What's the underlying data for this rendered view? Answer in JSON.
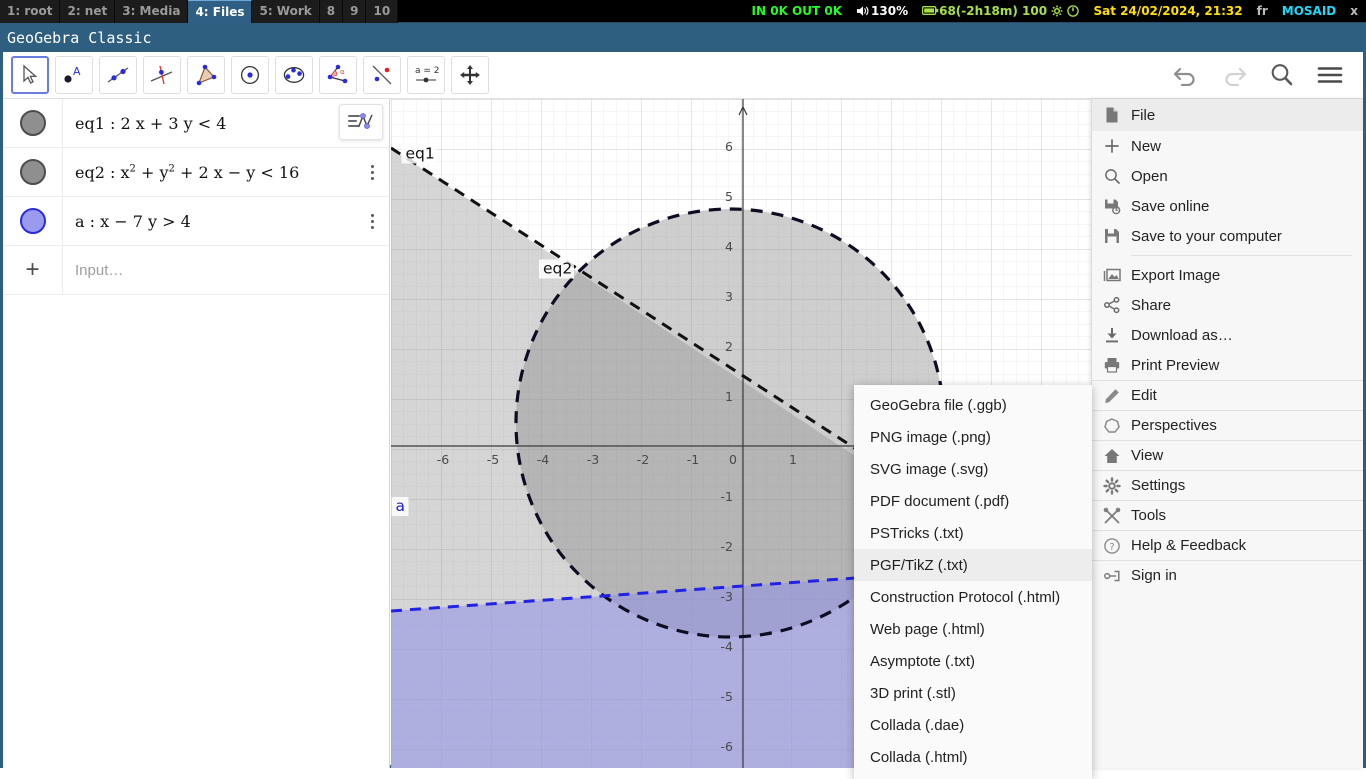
{
  "statusbar": {
    "workspaces": [
      {
        "label": "1: root",
        "selected": false
      },
      {
        "label": "2: net",
        "selected": false
      },
      {
        "label": "3: Media",
        "selected": false
      },
      {
        "label": "4: Files",
        "selected": true
      },
      {
        "label": "5: Work",
        "selected": false
      },
      {
        "label": "8",
        "selected": false
      },
      {
        "label": "9",
        "selected": false
      },
      {
        "label": "10",
        "selected": false
      }
    ],
    "net": "IN 0K OUT 0K",
    "volume": "130%",
    "battery": "68(-2h18m) 100",
    "datetime": "Sat 24/02/2024, 21:32",
    "keyboard": "fr",
    "host": "MOSAID",
    "close": "x"
  },
  "window": {
    "title": "GeoGebra Classic"
  },
  "toolbar": {
    "tools": [
      {
        "name": "move-tool",
        "active": true
      },
      {
        "name": "point-tool",
        "active": false
      },
      {
        "name": "line-tool",
        "active": false
      },
      {
        "name": "perpendicular-line-tool",
        "active": false
      },
      {
        "name": "polygon-tool",
        "active": false
      },
      {
        "name": "circle-tool",
        "active": false
      },
      {
        "name": "ellipse-tool",
        "active": false
      },
      {
        "name": "angle-tool",
        "active": false
      },
      {
        "name": "reflect-tool",
        "active": false
      },
      {
        "name": "slider-tool",
        "active": false
      },
      {
        "name": "move-graphics-tool",
        "active": false
      }
    ],
    "undo": "undo-icon",
    "redo": "redo-icon",
    "search": "search-icon",
    "menu": "hamburger-menu-icon"
  },
  "algebra": {
    "stylebar": "algebra-stylebar-icon",
    "rows": [
      {
        "name": "eq1",
        "expr_html": "eq1 : 2 x + 3 y &lt; 4",
        "color": "#8f8f8f",
        "visible": true
      },
      {
        "name": "eq2",
        "expr_html": "eq2 : x<sup>2</sup> + y<sup>2</sup> + 2 x &minus; y &lt; 16",
        "color": "#8f8f8f",
        "visible": true
      },
      {
        "name": "a",
        "expr_html": "a : x &minus; 7 y &gt; 4",
        "color": "#9a9aef",
        "visible": true
      }
    ],
    "input_placeholder": "Input…"
  },
  "chart_data": {
    "type": "scatter",
    "title": "",
    "xlabel": "x",
    "ylabel": "y",
    "xlim": [
      -7.1,
      2.4
    ],
    "ylim": [
      -6.6,
      6.6
    ],
    "grid": true,
    "xticks": [
      -6,
      -5,
      -4,
      -3,
      -2,
      -1,
      0,
      1
    ],
    "yticks": [
      6,
      5,
      4,
      3,
      2,
      1,
      -1,
      -2,
      -3,
      -4,
      -5,
      -6
    ],
    "annotations": [
      {
        "text": "eq1",
        "x": -6.75,
        "y": 5.75
      },
      {
        "text": "eq2",
        "x": -4.0,
        "y": 3.45
      },
      {
        "text": "a",
        "x": -6.95,
        "y": -1.3
      }
    ],
    "series": [
      {
        "name": "eq1",
        "label": "2x + 3y < 4",
        "kind": "linear-inequality",
        "color": "#000000",
        "fill": "#8c8c8c",
        "style": "dashed",
        "boundary_points": [
          [
            -7.1,
            6.07
          ],
          [
            2.4,
            -0.27
          ]
        ]
      },
      {
        "name": "eq2",
        "label": "x² + y² + 2x − y < 16",
        "kind": "circle-inequality",
        "color": "#101028",
        "fill": "#6e6e6e",
        "style": "dashed",
        "center": [
          -1,
          0.5
        ],
        "radius": 4.27
      },
      {
        "name": "a",
        "label": "x − 7y > 4",
        "kind": "linear-inequality",
        "color": "#2020e0",
        "fill": "#8f8fe8",
        "style": "dashed",
        "boundary_points": [
          [
            -7.1,
            -1.586
          ],
          [
            2.4,
            -0.229
          ]
        ]
      }
    ]
  },
  "graphics": {
    "stylebar": "graphics-stylebar-icon",
    "zoom_in": "zoom-in-icon",
    "zoom_out": "zoom-out-icon",
    "fit": "fit-to-screen-icon"
  },
  "mainmenu": {
    "items": [
      {
        "label": "File",
        "icon": "file-icon",
        "header": true
      },
      {
        "label": "New",
        "icon": "plus-icon"
      },
      {
        "label": "Open",
        "icon": "search-icon"
      },
      {
        "label": "Save online",
        "icon": "save-online-icon"
      },
      {
        "label": "Save to your computer",
        "icon": "save-disk-icon"
      },
      {
        "separator": true
      },
      {
        "label": "Export Image",
        "icon": "image-icon"
      },
      {
        "label": "Share",
        "icon": "share-icon"
      },
      {
        "label": "Download as…",
        "icon": "download-icon",
        "submenu": true
      },
      {
        "label": "Print Preview",
        "icon": "printer-icon"
      },
      {
        "label": "Edit",
        "icon": "pencil-icon",
        "section": true
      },
      {
        "label": "Perspectives",
        "icon": "perspectives-icon",
        "section": true
      },
      {
        "label": "View",
        "icon": "home-icon",
        "section": true
      },
      {
        "label": "Settings",
        "icon": "gear-icon",
        "section": true
      },
      {
        "label": "Tools",
        "icon": "tools-icon",
        "section": true
      },
      {
        "label": "Help & Feedback",
        "icon": "help-circle-icon",
        "section": true
      },
      {
        "label": "Sign in",
        "icon": "sign-in-icon",
        "section": true
      }
    ]
  },
  "export_submenu": {
    "items": [
      {
        "label": "GeoGebra file (.ggb)",
        "highlighted": false
      },
      {
        "label": "PNG image (.png)",
        "highlighted": false
      },
      {
        "label": "SVG image (.svg)",
        "highlighted": false
      },
      {
        "label": "PDF document (.pdf)",
        "highlighted": false
      },
      {
        "label": "PSTricks (.txt)",
        "highlighted": false
      },
      {
        "label": "PGF/TikZ (.txt)",
        "highlighted": true
      },
      {
        "label": "Construction Protocol (.html)",
        "highlighted": false
      },
      {
        "label": "Web page (.html)",
        "highlighted": false
      },
      {
        "label": "Asymptote (.txt)",
        "highlighted": false
      },
      {
        "label": "3D print (.stl)",
        "highlighted": false
      },
      {
        "label": "Collada (.dae)",
        "highlighted": false
      },
      {
        "label": "Collada (.html)",
        "highlighted": false
      }
    ]
  }
}
